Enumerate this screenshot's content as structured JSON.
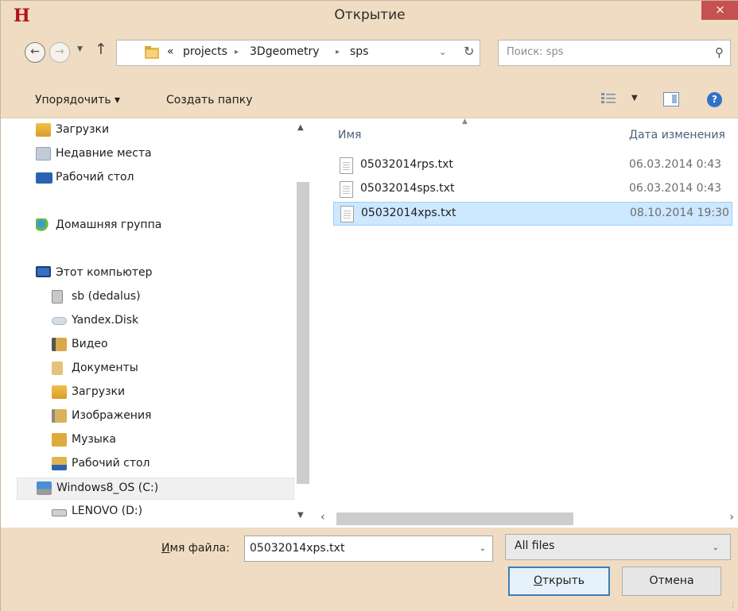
{
  "window": {
    "title": "Открытие",
    "close_label": "×",
    "app_icon": "Н"
  },
  "address": {
    "overflow": "«",
    "crumbs": [
      "projects",
      "3Dgeometry",
      "sps"
    ],
    "search_placeholder": "Поиск: sps"
  },
  "toolbar": {
    "organize_label": "Упорядочить ▾",
    "new_folder_label": "Создать папку"
  },
  "nav": {
    "items": [
      {
        "label": "Загрузки",
        "icon": "downloads-folder-icon",
        "color": "#f2c04c"
      },
      {
        "label": "Недавние места",
        "icon": "recent-places-icon",
        "color": "#8fa4b8"
      },
      {
        "label": "Рабочий стол",
        "icon": "desktop-icon",
        "color": "#2b62b3"
      },
      {
        "label": "Домашняя группа",
        "icon": "homegroup-icon",
        "color": "#3a9ad9"
      },
      {
        "label": "Этот компьютер",
        "icon": "computer-icon",
        "color": "#3670c4"
      },
      {
        "label": "sb (dedalus)",
        "icon": "network-drive-icon",
        "color": "#8a8a8a"
      },
      {
        "label": "Yandex.Disk",
        "icon": "cloud-drive-icon",
        "color": "#a6b5c6"
      },
      {
        "label": "Видео",
        "icon": "videos-folder-icon",
        "color": "#d9a94a"
      },
      {
        "label": "Документы",
        "icon": "documents-folder-icon",
        "color": "#e6c27a"
      },
      {
        "label": "Загрузки",
        "icon": "downloads-folder-icon",
        "color": "#f2c04c"
      },
      {
        "label": "Изображения",
        "icon": "pictures-folder-icon",
        "color": "#d9b25a"
      },
      {
        "label": "Музыка",
        "icon": "music-folder-icon",
        "color": "#e0a93c"
      },
      {
        "label": "Рабочий стол",
        "icon": "desktop-folder-icon",
        "color": "#e0b44e"
      },
      {
        "label": "Windows8_OS (C:)",
        "icon": "system-drive-icon",
        "color": "#4a8fd4"
      },
      {
        "label": "LENOVO (D:)",
        "icon": "disk-drive-icon",
        "color": "#9a9a9a"
      }
    ]
  },
  "files": {
    "col_name": "Имя",
    "col_date": "Дата изменения",
    "rows": [
      {
        "name": "05032014rps.txt",
        "date": "06.03.2014 0:43"
      },
      {
        "name": "05032014sps.txt",
        "date": "06.03.2014 0:43"
      },
      {
        "name": "05032014xps.txt",
        "date": "08.10.2014 19:30"
      }
    ]
  },
  "footer": {
    "filename_label_u": "И",
    "filename_label_rest": "мя файла:",
    "filename_value": "05032014xps.txt",
    "filetype_value": "All files",
    "open_u": "О",
    "open_rest": "ткрыть",
    "cancel_label": "Отмена"
  }
}
